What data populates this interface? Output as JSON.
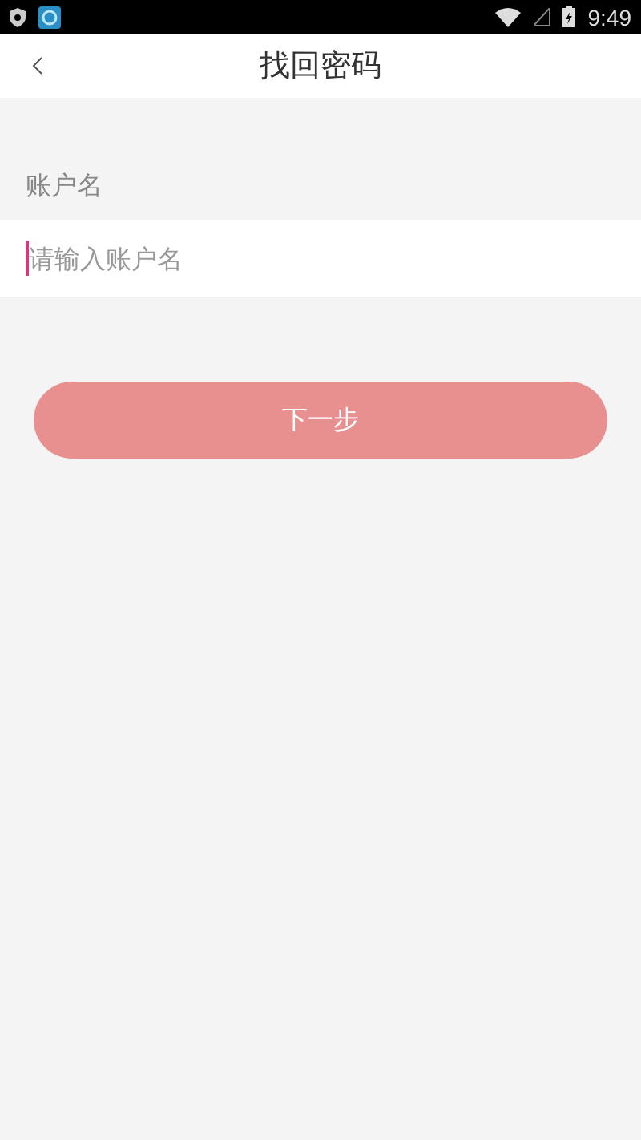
{
  "status_bar": {
    "time": "9:49"
  },
  "header": {
    "title": "找回密码"
  },
  "form": {
    "label": "账户名",
    "field": {
      "placeholder": "请输入账户名",
      "focused": true
    }
  },
  "next_button": {
    "label": "下一步",
    "disabled": true
  }
}
